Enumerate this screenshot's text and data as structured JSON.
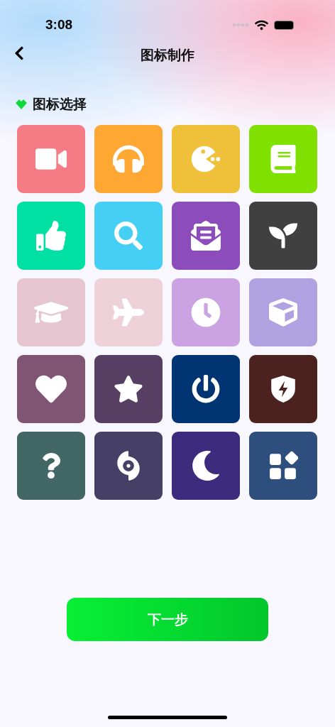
{
  "status_bar": {
    "time": "3:08"
  },
  "nav": {
    "title": "图标制作"
  },
  "section": {
    "title": "图标选择"
  },
  "tiles": [
    {
      "kind": "video",
      "color": "#f57b85"
    },
    {
      "kind": "headphones",
      "color": "#fea733"
    },
    {
      "kind": "pacman",
      "color": "#efc13b"
    },
    {
      "kind": "book",
      "color": "#80e000"
    },
    {
      "kind": "thumbs-up",
      "color": "#00e0a2"
    },
    {
      "kind": "search",
      "color": "#46cff5"
    },
    {
      "kind": "envelope",
      "color": "#8c4cbc"
    },
    {
      "kind": "sprout",
      "color": "#404040"
    },
    {
      "kind": "graduation",
      "color": "#e5c6d0"
    },
    {
      "kind": "plane",
      "color": "#eed1d9"
    },
    {
      "kind": "alarm",
      "color": "#cba3e2"
    },
    {
      "kind": "cube",
      "color": "#afa2e0"
    },
    {
      "kind": "heart",
      "color": "#805473"
    },
    {
      "kind": "star",
      "color": "#573f64"
    },
    {
      "kind": "power",
      "color": "#003473"
    },
    {
      "kind": "shield",
      "color": "#4b221e"
    },
    {
      "kind": "question",
      "color": "#426764"
    },
    {
      "kind": "hurricane",
      "color": "#474066"
    },
    {
      "kind": "moon",
      "color": "#3b2c7d"
    },
    {
      "kind": "grid",
      "color": "#2e4f7e"
    }
  ],
  "next_button": {
    "label": "下一步"
  }
}
